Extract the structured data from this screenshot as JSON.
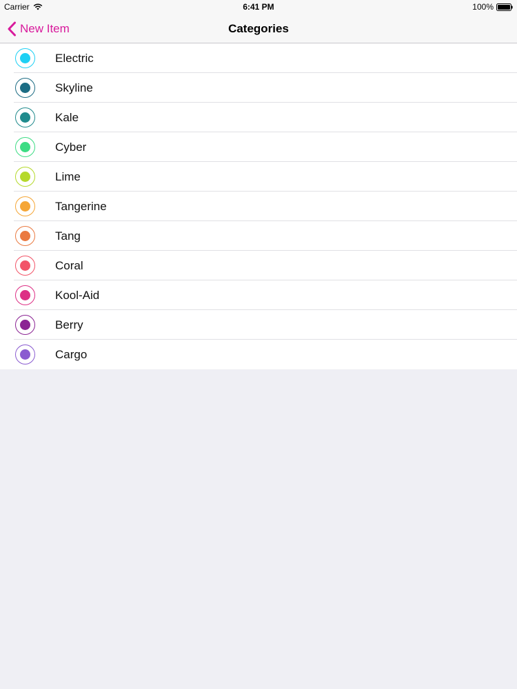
{
  "status_bar": {
    "carrier": "Carrier",
    "time": "6:41 PM",
    "battery": "100%"
  },
  "nav_bar": {
    "back_label": "New Item",
    "title": "Categories",
    "tint_color": "#d81b9c"
  },
  "categories": [
    {
      "name": "Electric",
      "color": "#1ed0f4"
    },
    {
      "name": "Skyline",
      "color": "#1d6d84"
    },
    {
      "name": "Kale",
      "color": "#218b8d"
    },
    {
      "name": "Cyber",
      "color": "#3ddc84"
    },
    {
      "name": "Lime",
      "color": "#b5d92b"
    },
    {
      "name": "Tangerine",
      "color": "#f5a636"
    },
    {
      "name": "Tang",
      "color": "#ea7a41"
    },
    {
      "name": "Coral",
      "color": "#f25468"
    },
    {
      "name": "Kool-Aid",
      "color": "#dd2f85"
    },
    {
      "name": "Berry",
      "color": "#8b2393"
    },
    {
      "name": "Cargo",
      "color": "#8a5bd0"
    }
  ]
}
